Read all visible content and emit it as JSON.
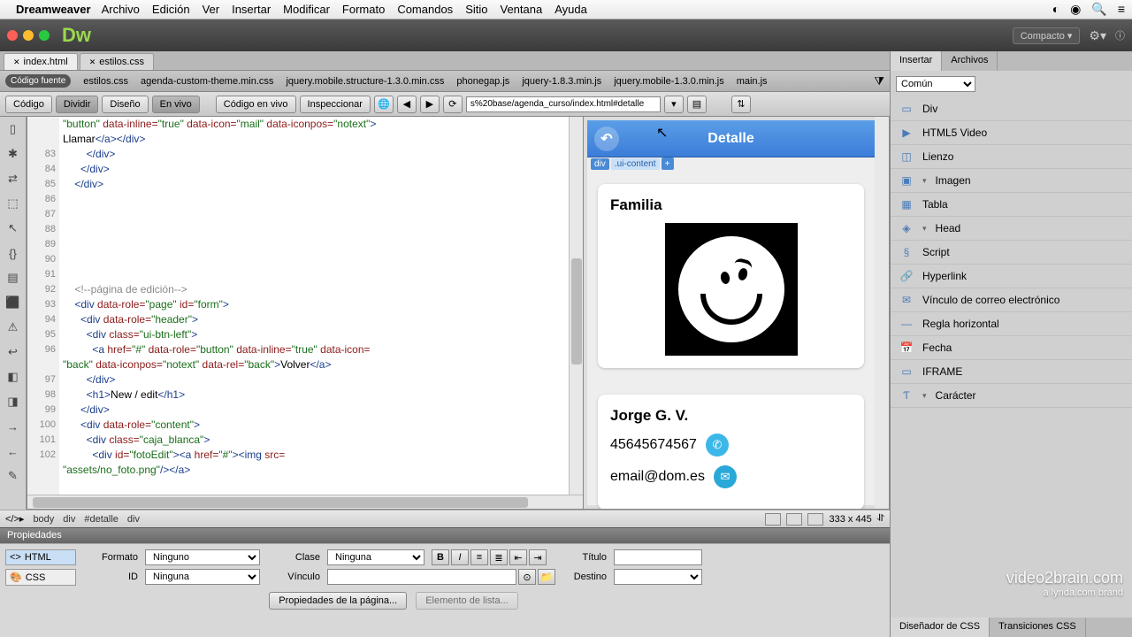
{
  "menubar": {
    "app": "Dreamweaver",
    "items": [
      "Archivo",
      "Edición",
      "Ver",
      "Insertar",
      "Modificar",
      "Formato",
      "Comandos",
      "Sitio",
      "Ventana",
      "Ayuda"
    ]
  },
  "titlebar": {
    "compact": "Compacto"
  },
  "doc_tabs": [
    {
      "label": "index.html",
      "active": true
    },
    {
      "label": "estilos.css",
      "active": false
    }
  ],
  "related_files": {
    "source_label": "Código fuente",
    "files": [
      "estilos.css",
      "agenda-custom-theme.min.css",
      "jquery.mobile.structure-1.3.0.min.css",
      "phonegap.js",
      "jquery-1.8.3.min.js",
      "jquery.mobile-1.3.0.min.js",
      "main.js"
    ]
  },
  "view_toolbar": {
    "code": "Código",
    "split": "Dividir",
    "design": "Diseño",
    "live": "En vivo",
    "live_code": "Código en vivo",
    "inspect": "Inspeccionar",
    "url": "s%20base/agenda_curso/index.html#detalle"
  },
  "code": {
    "lines": [
      {
        "n": "",
        "html": "<span class='c-str'>\"button\"</span> <span class='c-attr'>data-inline=</span><span class='c-str'>\"true\"</span> <span class='c-attr'>data-icon=</span><span class='c-str'>\"mail\"</span> <span class='c-attr'>data-iconpos=</span><span class='c-str'>\"notext\"</span><span class='c-tag'>&gt;</span>"
      },
      {
        "n": "",
        "html": "<span class='c-txt'>Llamar</span><span class='c-tag'>&lt;/a&gt;&lt;/div&gt;</span>"
      },
      {
        "n": "83",
        "html": "        <span class='c-tag'>&lt;/div&gt;</span>"
      },
      {
        "n": "84",
        "html": "      <span class='c-tag'>&lt;/div&gt;</span>"
      },
      {
        "n": "85",
        "html": "    <span class='c-tag'>&lt;/div&gt;</span>"
      },
      {
        "n": "86",
        "html": ""
      },
      {
        "n": "87",
        "html": ""
      },
      {
        "n": "88",
        "html": ""
      },
      {
        "n": "89",
        "html": ""
      },
      {
        "n": "90",
        "html": ""
      },
      {
        "n": "91",
        "html": ""
      },
      {
        "n": "92",
        "html": "    <span class='c-cmt'>&lt;!--página de edición--&gt;</span>"
      },
      {
        "n": "93",
        "html": "    <span class='c-tag'>&lt;div</span> <span class='c-attr'>data-role=</span><span class='c-str'>\"page\"</span> <span class='c-attr'>id=</span><span class='c-str'>\"form\"</span><span class='c-tag'>&gt;</span>"
      },
      {
        "n": "94",
        "html": "      <span class='c-tag'>&lt;div</span> <span class='c-attr'>data-role=</span><span class='c-str'>\"header\"</span><span class='c-tag'>&gt;</span>"
      },
      {
        "n": "95",
        "html": "        <span class='c-tag'>&lt;div</span> <span class='c-attr'>class=</span><span class='c-str'>\"ui-btn-left\"</span><span class='c-tag'>&gt;</span>"
      },
      {
        "n": "96",
        "html": "          <span class='c-tag'>&lt;a</span> <span class='c-attr'>href=</span><span class='c-str'>\"#\"</span> <span class='c-attr'>data-role=</span><span class='c-str'>\"button\"</span> <span class='c-attr'>data-inline=</span><span class='c-str'>\"true\"</span> <span class='c-attr'>data-icon=</span>"
      },
      {
        "n": "",
        "html": "<span class='c-str'>\"back\"</span> <span class='c-attr'>data-iconpos=</span><span class='c-str'>\"notext\"</span> <span class='c-attr'>data-rel=</span><span class='c-str'>\"back\"</span><span class='c-tag'>&gt;</span><span class='c-txt'>Volver</span><span class='c-tag'>&lt;/a&gt;</span>"
      },
      {
        "n": "97",
        "html": "        <span class='c-tag'>&lt;/div&gt;</span>"
      },
      {
        "n": "98",
        "html": "        <span class='c-tag'>&lt;h1&gt;</span><span class='c-txt'>New / edit</span><span class='c-tag'>&lt;/h1&gt;</span>"
      },
      {
        "n": "99",
        "html": "      <span class='c-tag'>&lt;/div&gt;</span>"
      },
      {
        "n": "100",
        "html": "      <span class='c-tag'>&lt;div</span> <span class='c-attr'>data-role=</span><span class='c-str'>\"content\"</span><span class='c-tag'>&gt;</span>"
      },
      {
        "n": "101",
        "html": "        <span class='c-tag'>&lt;div</span> <span class='c-attr'>class=</span><span class='c-str'>\"caja_blanca\"</span><span class='c-tag'>&gt;</span>"
      },
      {
        "n": "102",
        "html": "          <span class='c-tag'>&lt;div</span> <span class='c-attr'>id=</span><span class='c-str'>\"fotoEdit\"</span><span class='c-tag'>&gt;&lt;a</span> <span class='c-attr'>href=</span><span class='c-str'>\"#\"</span><span class='c-tag'>&gt;&lt;img</span> <span class='c-attr'>src=</span>"
      },
      {
        "n": "",
        "html": "<span class='c-str'>\"assets/no_foto.png\"</span><span class='c-tag'>/&gt;&lt;/a&gt;</span>"
      }
    ]
  },
  "preview": {
    "header": "Detalle",
    "dom_tag_div": "div",
    "dom_tag_class": ".ui-content",
    "category": "Familia",
    "name": "Jorge G. V.",
    "phone": "45645674567",
    "email": "email@dom.es"
  },
  "tag_bar": {
    "crumbs": [
      "body",
      "div",
      "#detalle",
      "div"
    ],
    "size": "333 x 445"
  },
  "properties": {
    "title": "Propiedades",
    "html_mode": "HTML",
    "css_mode": "CSS",
    "format_label": "Formato",
    "format_value": "Ninguno",
    "class_label": "Clase",
    "class_value": "Ninguna",
    "title_label": "Título",
    "id_label": "ID",
    "id_value": "Ninguna",
    "link_label": "Vínculo",
    "target_label": "Destino",
    "page_props": "Propiedades de la página...",
    "list_item": "Elemento de lista..."
  },
  "insert_panel": {
    "tabs": [
      "Insertar",
      "Archivos"
    ],
    "category": "Común",
    "items": [
      {
        "icon": "▭",
        "label": "Div"
      },
      {
        "icon": "▶",
        "label": "HTML5 Video"
      },
      {
        "icon": "◫",
        "label": "Lienzo"
      },
      {
        "icon": "▣",
        "label": "Imagen",
        "dd": true
      },
      {
        "icon": "▦",
        "label": "Tabla"
      },
      {
        "icon": "◈",
        "label": "Head",
        "dd": true
      },
      {
        "icon": "§",
        "label": "Script"
      },
      {
        "icon": "🔗",
        "label": "Hyperlink"
      },
      {
        "icon": "✉",
        "label": "Vínculo de correo electrónico"
      },
      {
        "icon": "—",
        "label": "Regla horizontal"
      },
      {
        "icon": "📅",
        "label": "Fecha"
      },
      {
        "icon": "▭",
        "label": "IFRAME"
      },
      {
        "icon": "Ƭ",
        "label": "Carácter",
        "dd": true
      }
    ],
    "bottom_tabs": [
      "Diseñador de CSS",
      "Transiciones CSS"
    ]
  },
  "watermark": {
    "brand": "video2brain.com",
    "sub": "a lynda.com brand"
  }
}
